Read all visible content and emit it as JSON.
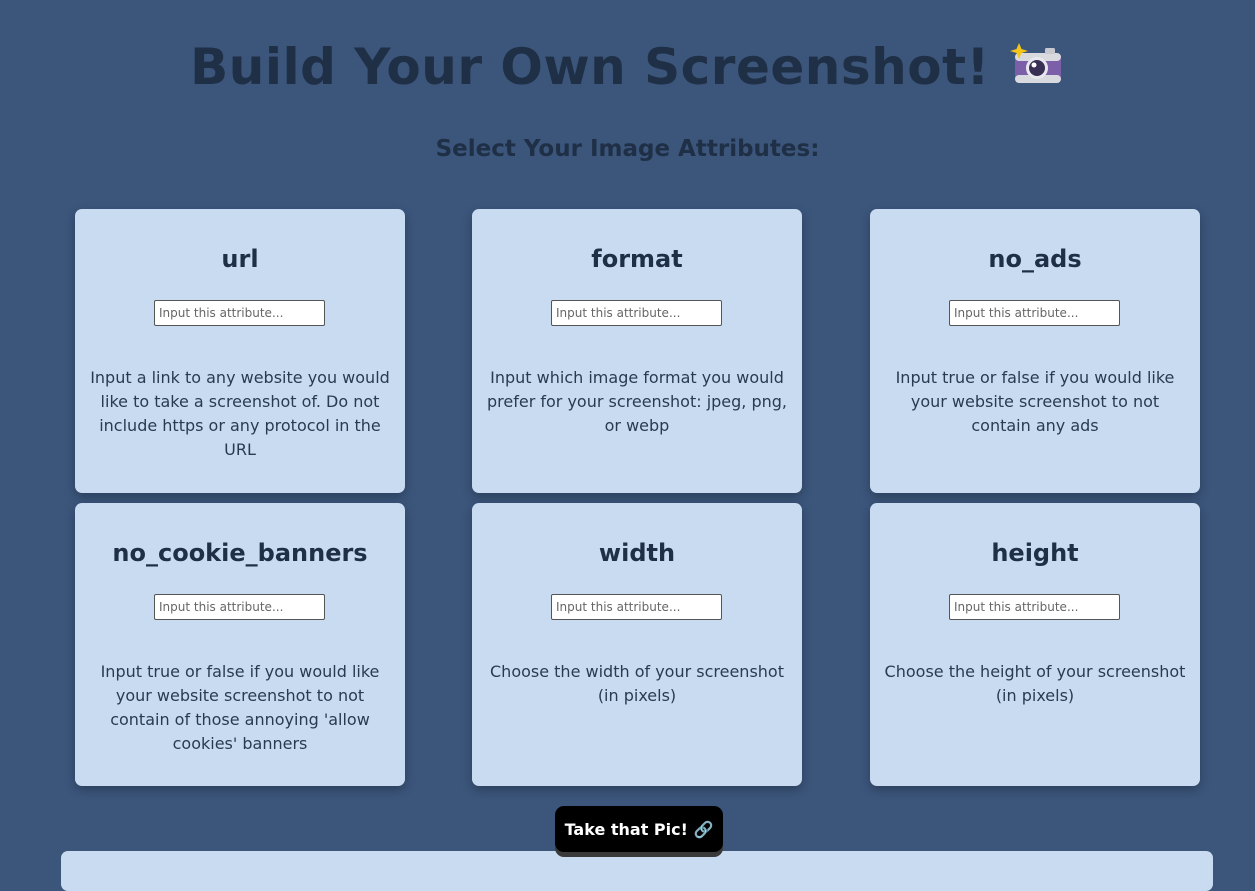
{
  "header": {
    "title": "Build Your Own Screenshot!",
    "title_icon": "camera-with-flash-icon",
    "subtitle": "Select Your Image Attributes:"
  },
  "cards": [
    {
      "title": "url",
      "placeholder": "Input this attribute...",
      "value": "",
      "description": "Input a link to any website you would like to take a screenshot of. Do not include https or any protocol in the URL"
    },
    {
      "title": "format",
      "placeholder": "Input this attribute...",
      "value": "",
      "description": "Input which image format you would prefer for your screenshot: jpeg, png, or webp"
    },
    {
      "title": "no_ads",
      "placeholder": "Input this attribute...",
      "value": "",
      "description": "Input true or false if you would like your website screenshot to not contain any ads"
    },
    {
      "title": "no_cookie_banners",
      "placeholder": "Input this attribute...",
      "value": "",
      "description": "Input true or false if you would like your website screenshot to not contain of those annoying 'allow cookies' banners"
    },
    {
      "title": "width",
      "placeholder": "Input this attribute...",
      "value": "",
      "description": "Choose the width of your screenshot (in pixels)"
    },
    {
      "title": "height",
      "placeholder": "Input this attribute...",
      "value": "",
      "description": "Choose the height of your screenshot (in pixels)"
    }
  ],
  "submit": {
    "label": "Take that Pic! 🔗"
  },
  "colors": {
    "background": "#3b557b",
    "card": "#c9dbf1",
    "text": "#1f2f45",
    "button": "#000000"
  }
}
